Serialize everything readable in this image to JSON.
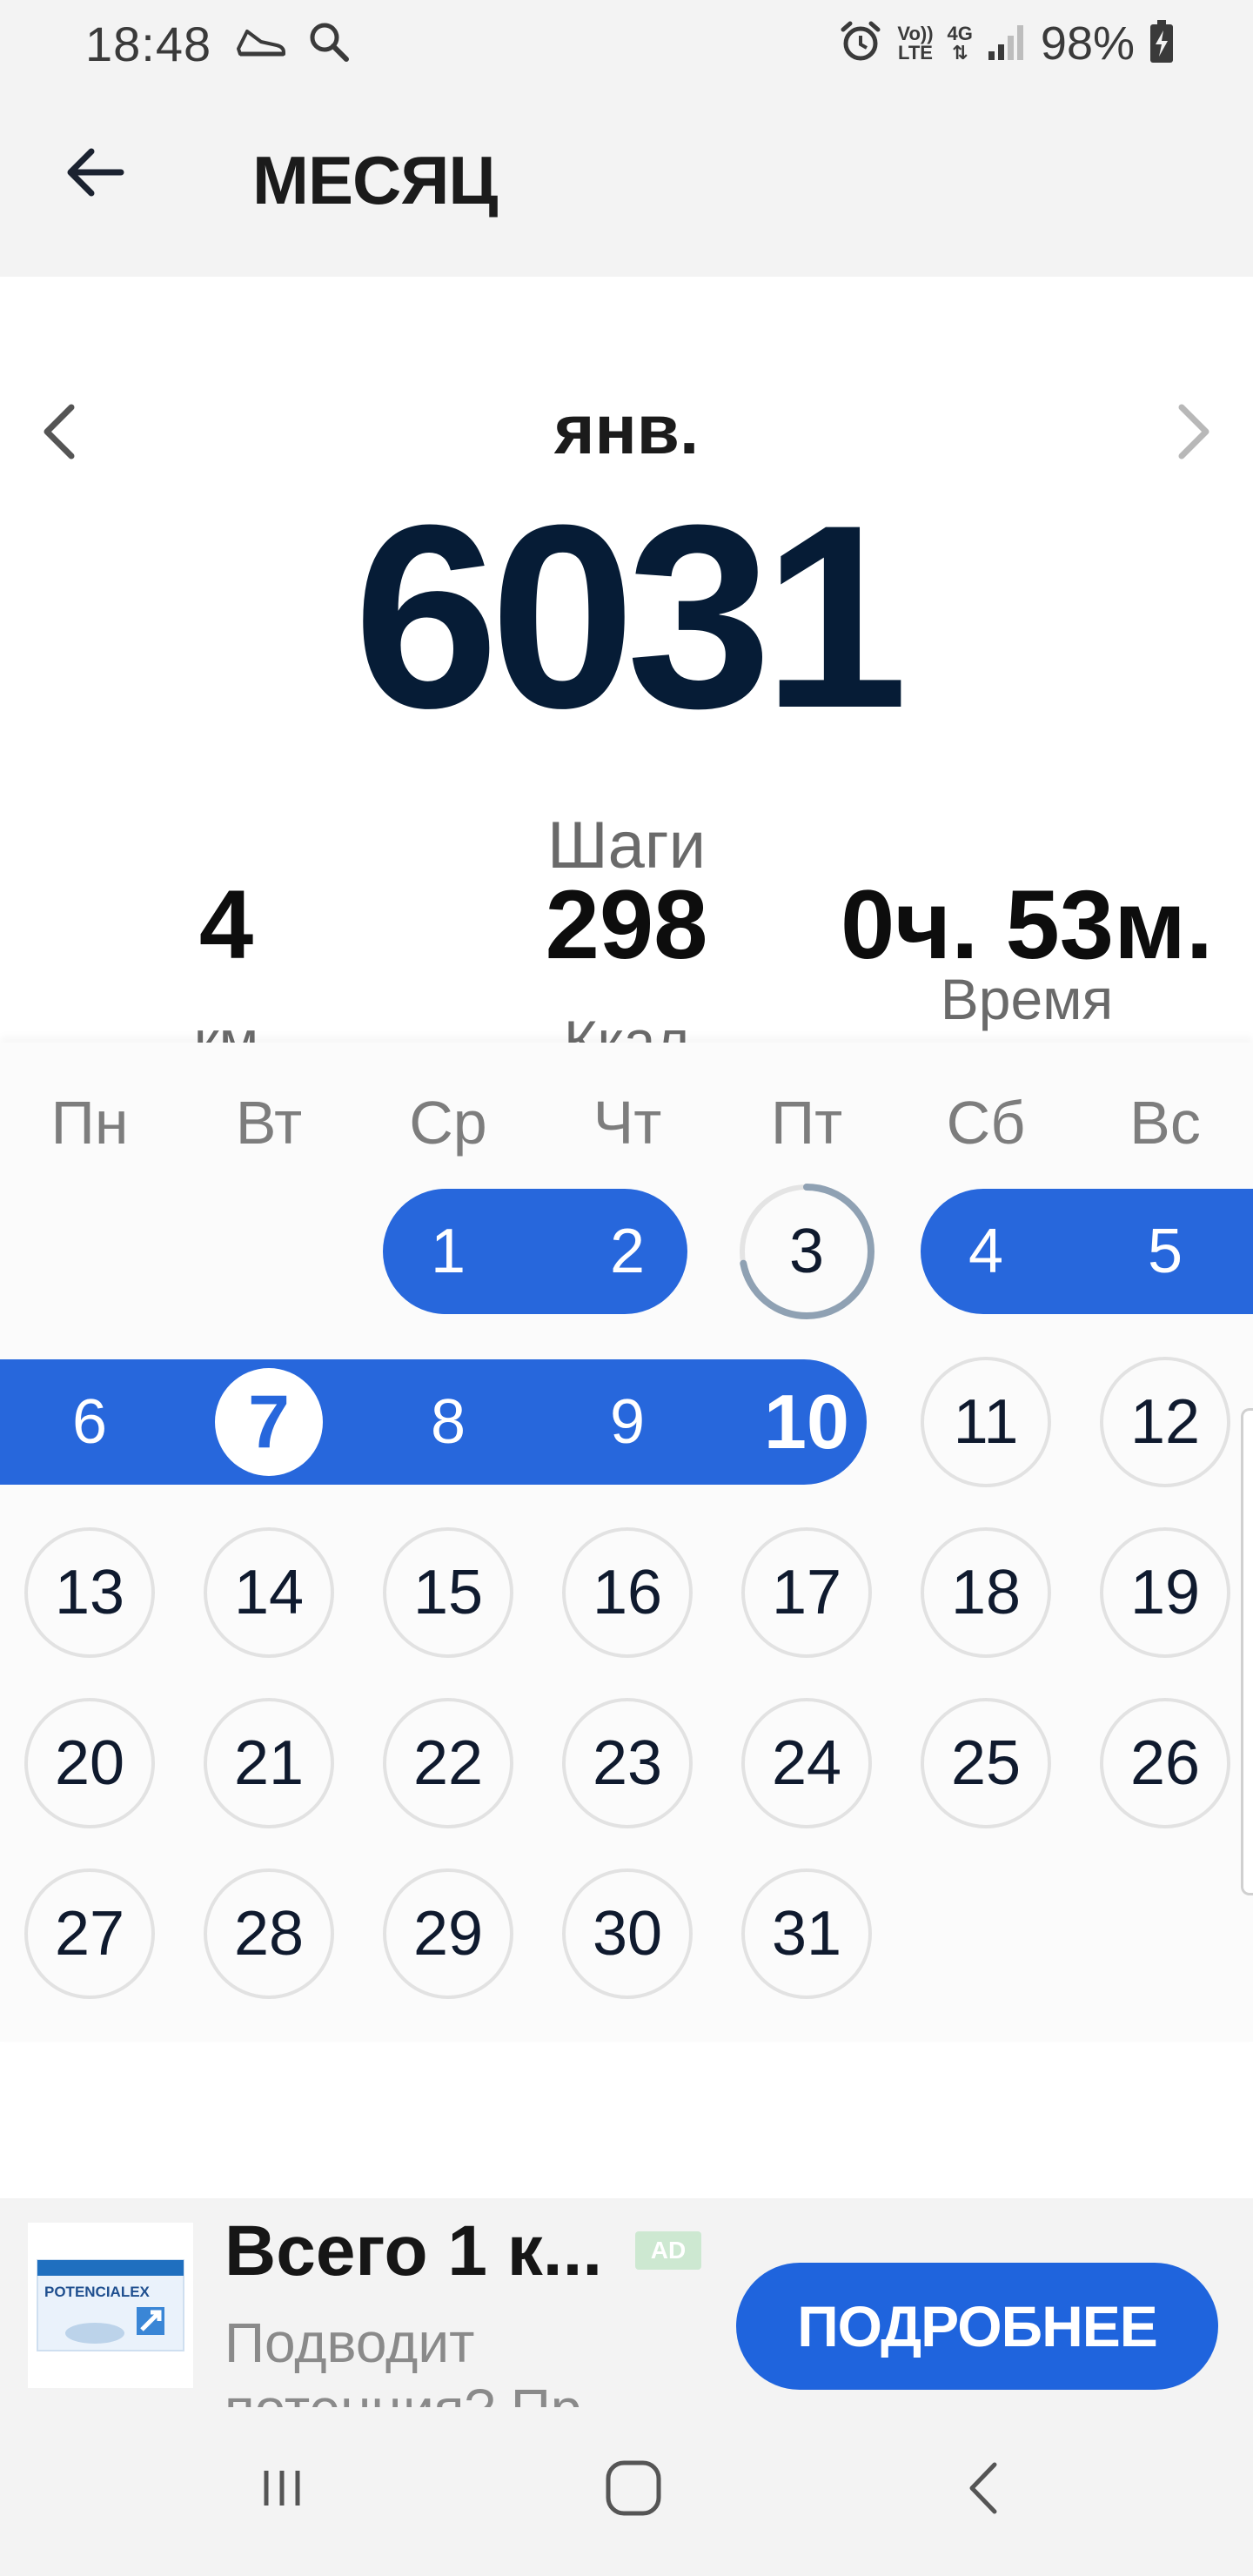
{
  "status_bar": {
    "time": "18:48",
    "volte_line1": "Vo))",
    "volte_line2": "LTE",
    "network": "4G",
    "battery": "98%"
  },
  "app_bar": {
    "title": "МЕСЯЦ"
  },
  "summary": {
    "month": "янв.",
    "steps_value": "6031",
    "steps_label": "Шаги",
    "distance_value": "4",
    "distance_label": "км",
    "calories_value": "298",
    "calories_label": "Ккал",
    "time_value": "0ч. 53м.",
    "time_label": "Время"
  },
  "calendar": {
    "weekdays": [
      "Пн",
      "Вт",
      "Ср",
      "Чт",
      "Пт",
      "Сб",
      "Вс"
    ],
    "days": {
      "d1": "1",
      "d2": "2",
      "d3": "3",
      "d4": "4",
      "d5": "5",
      "d6": "6",
      "d7": "7",
      "d8": "8",
      "d9": "9",
      "d10": "10",
      "d11": "11",
      "d12": "12",
      "d13": "13",
      "d14": "14",
      "d15": "15",
      "d16": "16",
      "d17": "17",
      "d18": "18",
      "d19": "19",
      "d20": "20",
      "d21": "21",
      "d22": "22",
      "d23": "23",
      "d24": "24",
      "d25": "25",
      "d26": "26",
      "d27": "27",
      "d28": "28",
      "d29": "29",
      "d30": "30",
      "d31": "31"
    },
    "day3_goal_progress": 0.72,
    "accent_color": "#2767dc"
  },
  "ad": {
    "headline": "Всего 1 к...",
    "badge": "AD",
    "body": "Подводит потенция? Пр",
    "cta": "ПОДРОБНЕЕ",
    "image_brand": "POTENCIALEX"
  },
  "icons": {
    "back": "arrow-left-icon",
    "prev": "chevron-left-icon",
    "next": "chevron-right-icon"
  }
}
